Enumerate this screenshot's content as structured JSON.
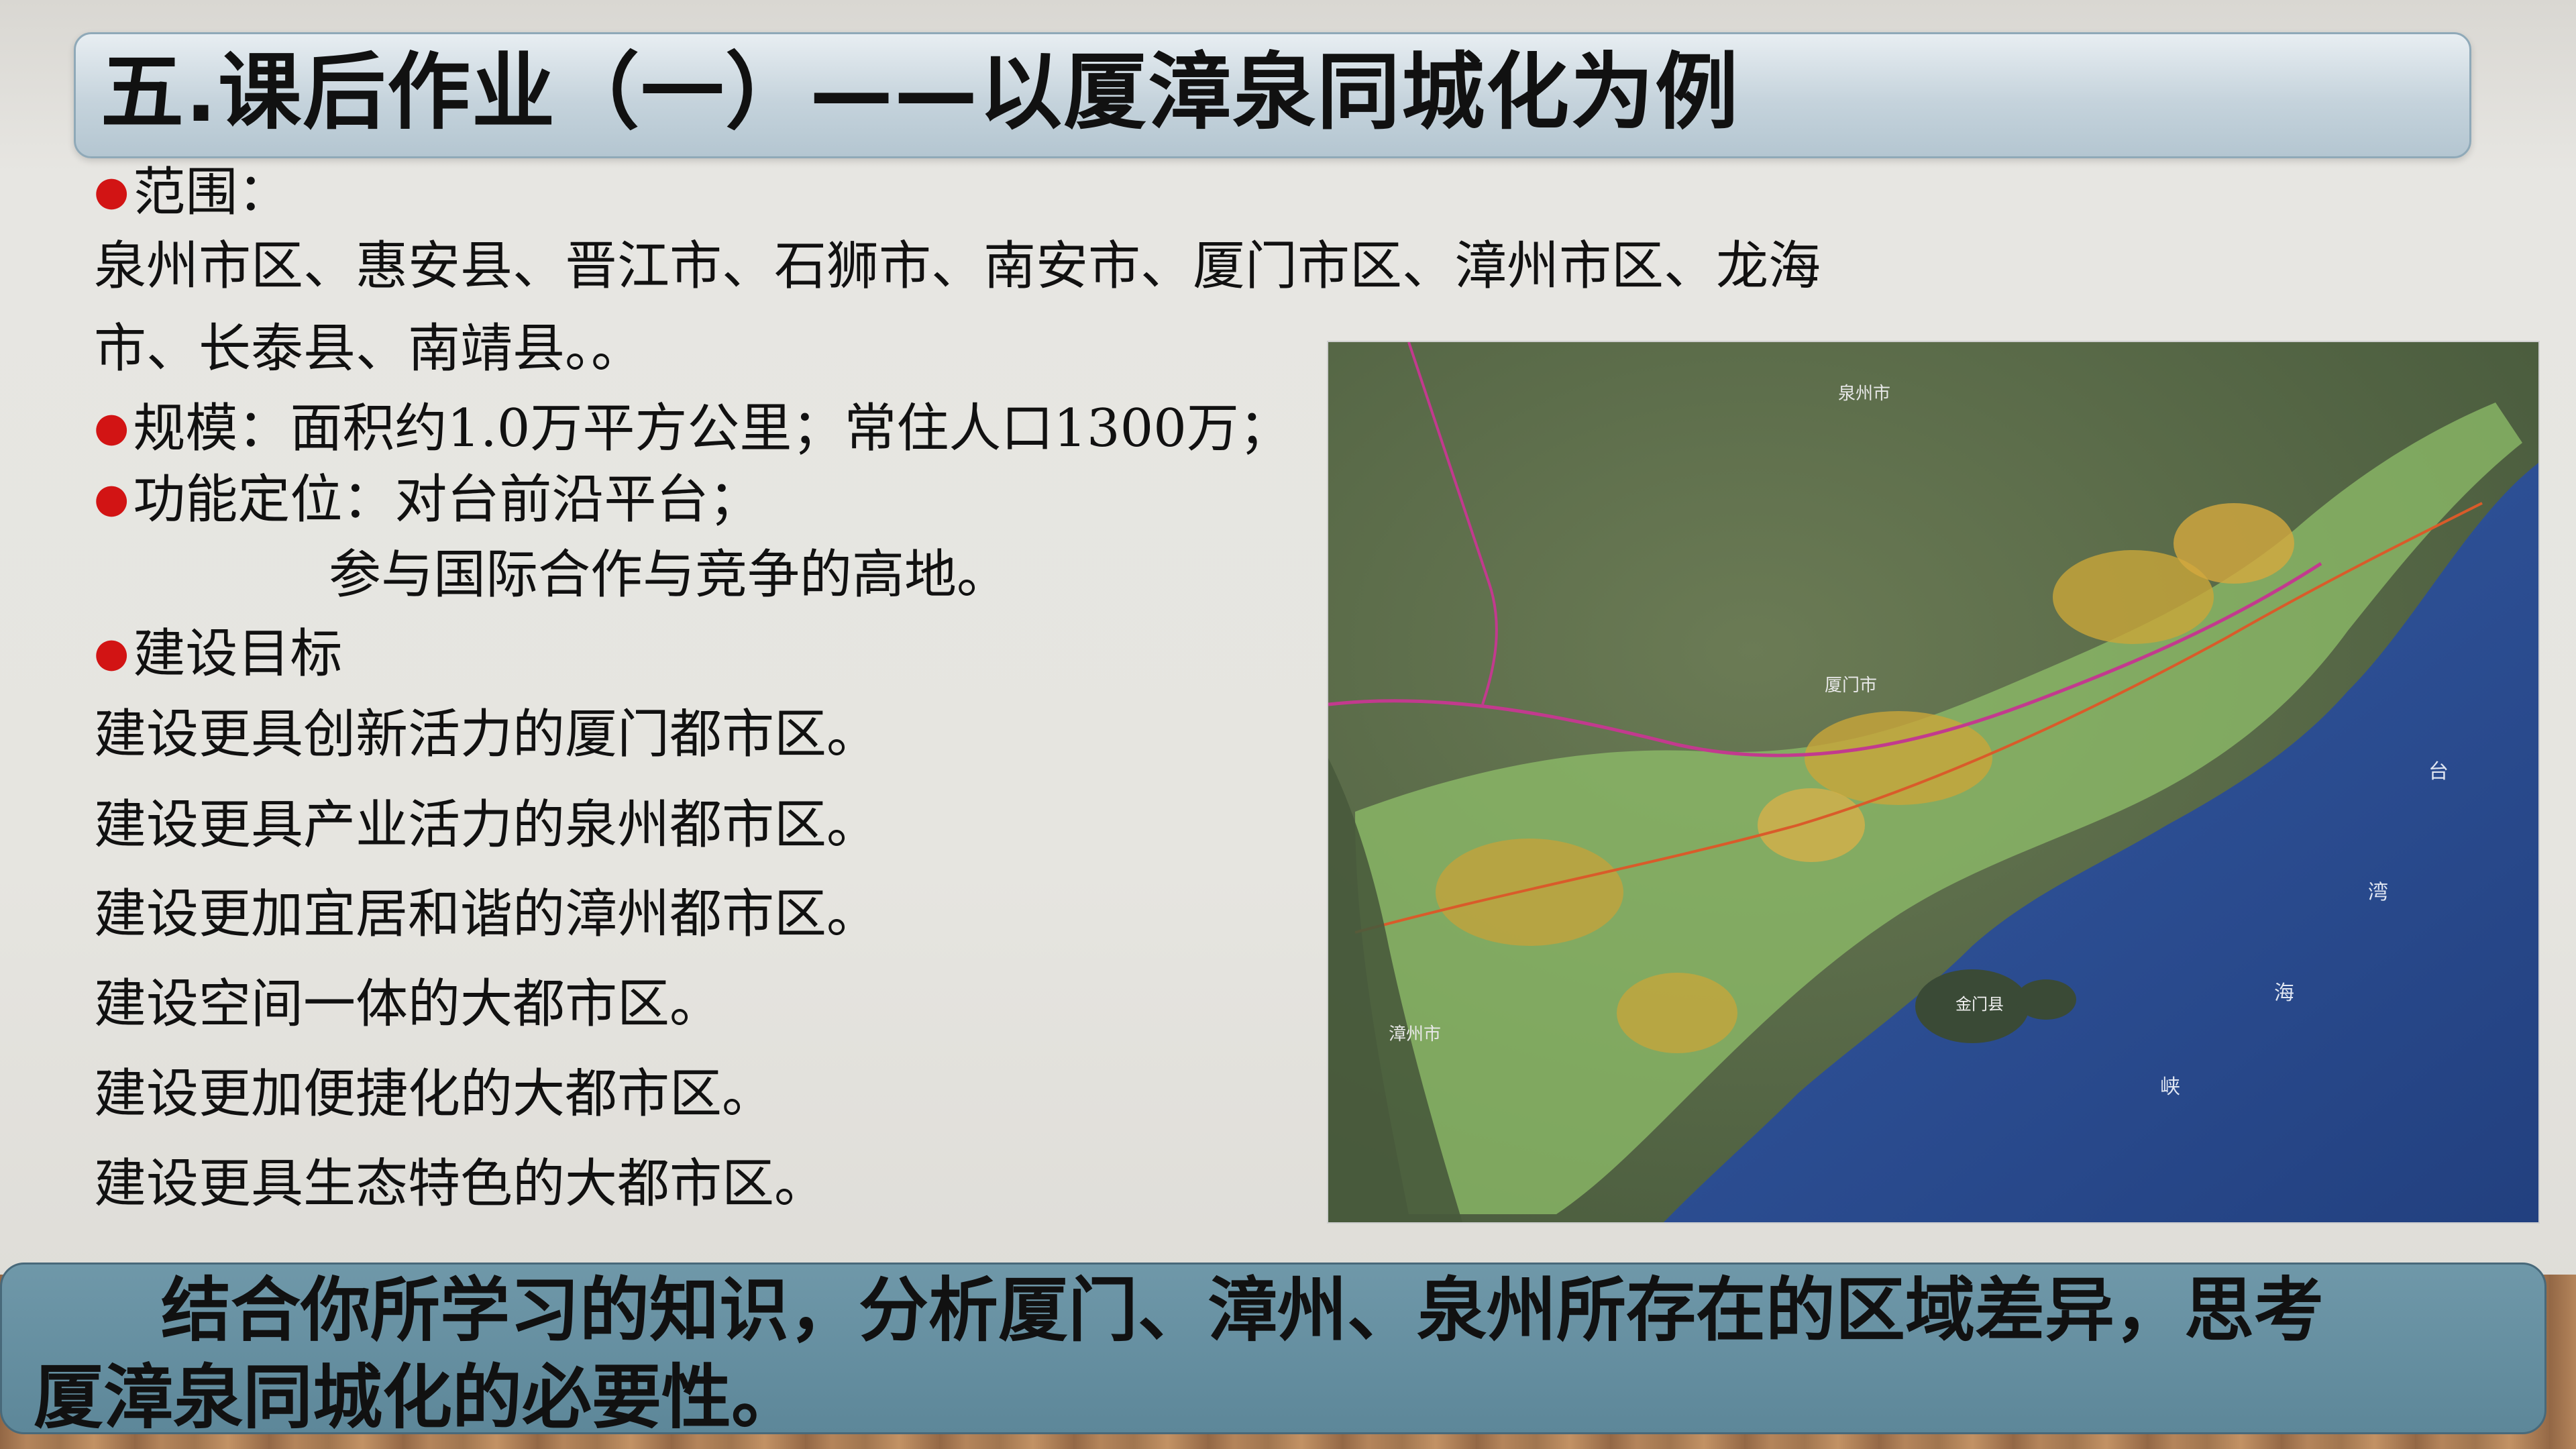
{
  "header": {
    "title": "五.课后作业（一）——以厦漳泉同城化为例"
  },
  "content": {
    "scope_label": "范围：",
    "scope_line1": "泉州市区、惠安县、晋江市、石狮市、南安市、厦门市区、漳州市区、龙海",
    "scope_line2": "市、长泰县、南靖县。。",
    "scale": "规模：面积约1.0万平方公里；常住人口1300万；",
    "function_line1": "功能定位：对台前沿平台；",
    "function_line2": "参与国际合作与竞争的高地。",
    "goals_label": "建设目标",
    "goals": [
      "建设更具创新活力的厦门都市区。",
      "建设更具产业活力的泉州都市区。",
      "建设更加宜居和谐的漳州都市区。",
      "建设空间一体的大都市区。",
      "建设更加便捷化的大都市区。",
      "建设更具生态特色的大都市区。"
    ]
  },
  "map": {
    "labels": {
      "quanzhou": "泉州市",
      "xiamen": "厦门市",
      "zhangzhou": "漳州市",
      "jinmen": "金门县",
      "strait": [
        "台",
        "湾",
        "海",
        "峡"
      ]
    },
    "colors": {
      "sea": "#2f4f9a",
      "land": "#5d6e4a",
      "urban": "#c9a63a",
      "boundary": "#c23a8e"
    }
  },
  "task": {
    "line1": "结合你所学习的知识，分析厦门、漳州、泉州所存在的区域差异，思考",
    "line2": "厦漳泉同城化的必要性。"
  }
}
